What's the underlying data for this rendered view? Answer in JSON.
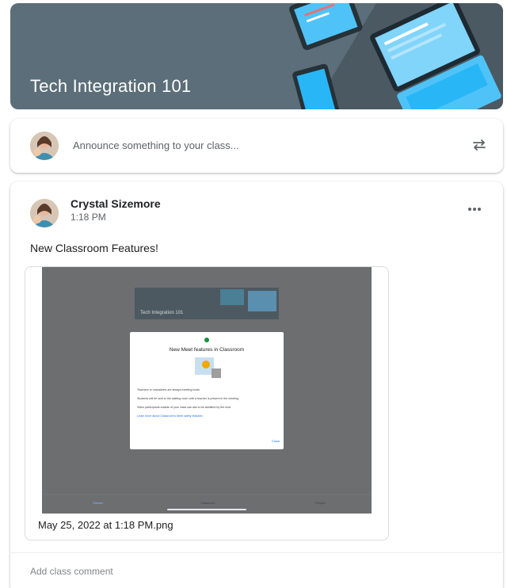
{
  "banner": {
    "title": "Tech Integration 101"
  },
  "announce": {
    "placeholder": "Announce something to your class..."
  },
  "post": {
    "author": "Crystal Sizemore",
    "time": "1:18 PM",
    "text": "New Classroom Features!",
    "attachment": {
      "filename": "May 25, 2022 at 1:18 PM.png",
      "preview": {
        "class_title": "Tech Integration 101",
        "dialog_title": "New Meet features in Classroom",
        "bullets": [
          "Teachers or coteachers are always meeting hosts",
          "Students will be sent to the waiting room until a teacher is present in the meeting",
          "Video participants outside of your class can ask to be admitted by the host",
          "Learn more about Classroom's Meet safety features"
        ],
        "close_label": "Close",
        "nav": [
          "Stream",
          "Classwork",
          "People"
        ]
      }
    },
    "comment_placeholder": "Add class comment"
  },
  "colors": {
    "banner": "#5b6e79",
    "accent": "#1a73e8"
  }
}
